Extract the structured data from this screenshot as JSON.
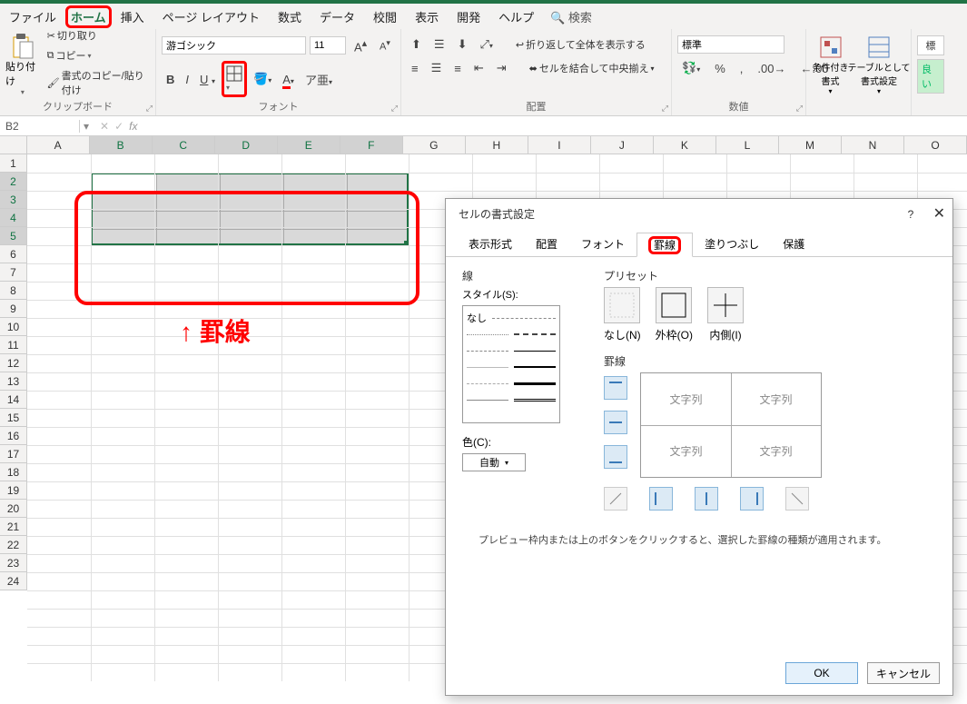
{
  "tabs": {
    "file": "ファイル",
    "home": "ホーム",
    "insert": "挿入",
    "pagelayout": "ページ レイアウト",
    "formulas": "数式",
    "data": "データ",
    "review": "校閲",
    "view": "表示",
    "developer": "開発",
    "help": "ヘルプ",
    "search": "検索"
  },
  "ribbon": {
    "clipboard": {
      "paste": "貼り付け",
      "cut": "切り取り",
      "copy": "コピー",
      "formatpainter": "書式のコピー/貼り付け",
      "label": "クリップボード"
    },
    "font": {
      "name": "游ゴシック",
      "size": "11",
      "label": "フォント"
    },
    "alignment": {
      "wrap": "折り返して全体を表示する",
      "merge": "セルを結合して中央揃え",
      "label": "配置"
    },
    "number": {
      "format": "標準",
      "label": "数値"
    },
    "styles": {
      "cond": "条件付き\n書式",
      "table": "テーブルとして\n書式設定"
    },
    "misc": {
      "standard": "標",
      "good": "良い"
    }
  },
  "namebox": "B2",
  "columns": [
    "A",
    "B",
    "C",
    "D",
    "E",
    "F",
    "G",
    "H",
    "I",
    "J",
    "K",
    "L",
    "M",
    "N",
    "O"
  ],
  "rows": [
    "1",
    "2",
    "3",
    "4",
    "5",
    "6",
    "7",
    "8",
    "9",
    "10",
    "11",
    "12",
    "13",
    "14",
    "15",
    "16",
    "17",
    "18",
    "19",
    "20",
    "21",
    "22",
    "23",
    "24"
  ],
  "annotation": "↑ 罫線",
  "dialog": {
    "title": "セルの書式設定",
    "tabs": {
      "format": "表示形式",
      "align": "配置",
      "font": "フォント",
      "border": "罫線",
      "fill": "塗りつぶし",
      "protect": "保護"
    },
    "line_label": "線",
    "style_label": "スタイル(S):",
    "none": "なし",
    "preset_label": "プリセット",
    "preset_none": "なし(N)",
    "preset_outline": "外枠(O)",
    "preset_inside": "内側(I)",
    "border_label": "罫線",
    "color_label": "色(C):",
    "color_auto": "自動",
    "sample": "文字列",
    "hint": "プレビュー枠内または上のボタンをクリックすると、選択した罫線の種類が適用されます。",
    "ok": "OK",
    "cancel": "キャンセル"
  }
}
